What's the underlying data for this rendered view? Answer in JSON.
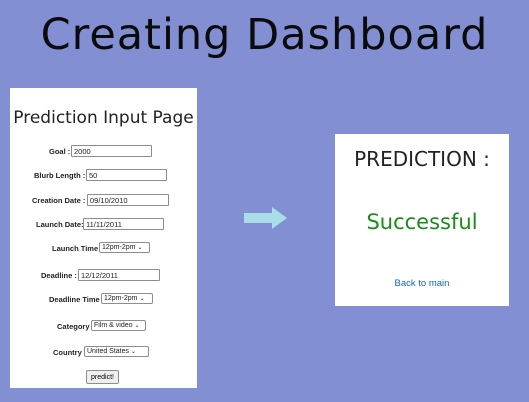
{
  "slide": {
    "title": "Creating Dashboard"
  },
  "form": {
    "title": "Prediction Input Page",
    "fields": {
      "goal": {
        "label": "Goal :",
        "value": "2000"
      },
      "blurb_length": {
        "label": "Blurb Length :",
        "value": "50"
      },
      "creation_date": {
        "label": "Creation Date :",
        "value": "09/10/2010"
      },
      "launch_date": {
        "label": "Launch Date:",
        "value": "11/11/2011"
      },
      "launch_time": {
        "label": "Launch Time",
        "value": "12pm-2pm"
      },
      "deadline": {
        "label": "Deadline :",
        "value": "12/12/2011"
      },
      "deadline_time": {
        "label": "Deadline Time",
        "value": "12pm-2pm"
      },
      "category": {
        "label": "Category",
        "value": "Film & video"
      },
      "country": {
        "label": "Country",
        "value": "United States"
      }
    },
    "submit_label": "predict!"
  },
  "arrow": {
    "icon": "right-arrow-icon",
    "color": "#a9dde8"
  },
  "result": {
    "title": "PREDICTION :",
    "status": "Successful",
    "status_color": "#1a8a1a",
    "back_link": "Back to main"
  }
}
